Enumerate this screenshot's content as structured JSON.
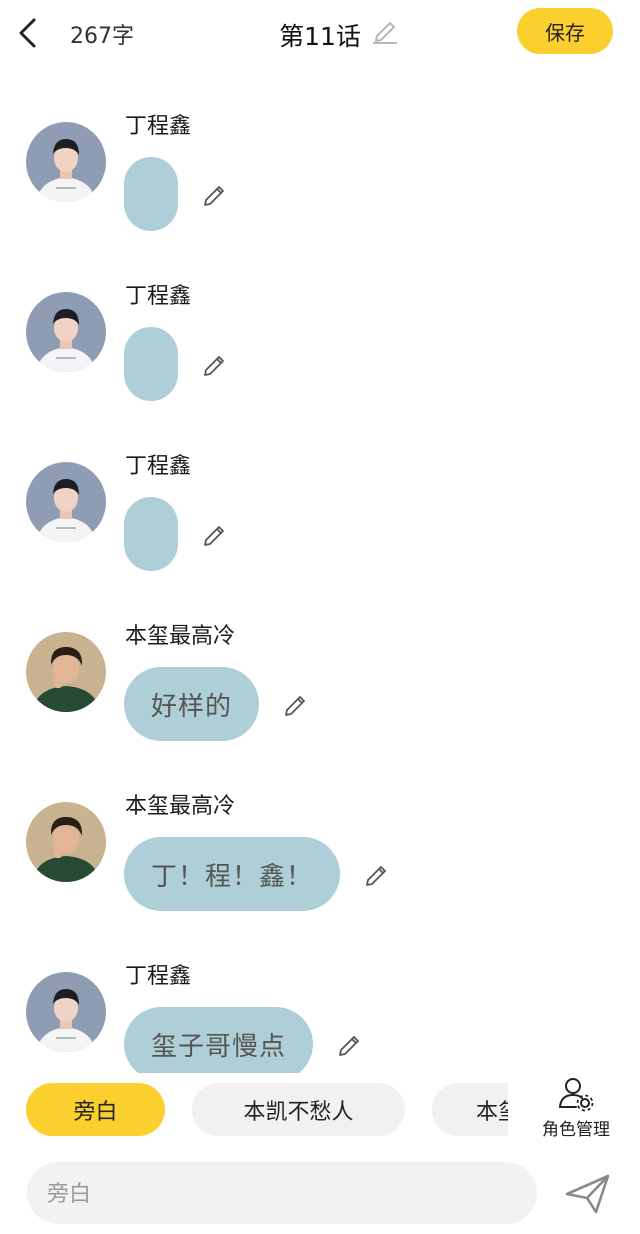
{
  "header": {
    "word_count": "267字",
    "title": "第11话",
    "save_label": "保存"
  },
  "messages": [
    {
      "sender": "丁程鑫",
      "text": "",
      "avatar": "avatar-a"
    },
    {
      "sender": "丁程鑫",
      "text": "",
      "avatar": "avatar-a"
    },
    {
      "sender": "丁程鑫",
      "text": "",
      "avatar": "avatar-a"
    },
    {
      "sender": "本玺最高冷",
      "text": "好样的",
      "avatar": "avatar-b"
    },
    {
      "sender": "本玺最高冷",
      "text": "丁！程！鑫！",
      "avatar": "avatar-b"
    },
    {
      "sender": "丁程鑫",
      "text": "玺子哥慢点",
      "avatar": "avatar-a"
    }
  ],
  "roles": {
    "tabs": [
      "旁白",
      "本凯不愁人",
      "本玺最高冷"
    ],
    "active": "旁白",
    "manage_label": "角色管理"
  },
  "input": {
    "placeholder": "旁白"
  },
  "colors": {
    "accent": "#fbd02e",
    "bubble": "#aecfd8",
    "chip_bg": "#f1f1f1",
    "input_bg": "#f2f2f2"
  },
  "icons": [
    "back-arrow-icon",
    "edit-pencil-icon",
    "pencil-icon",
    "role-manage-icon",
    "send-icon"
  ]
}
